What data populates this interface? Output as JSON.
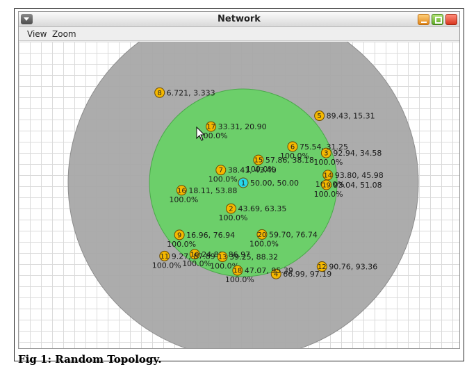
{
  "window": {
    "title": "Network",
    "menu": {
      "view": "View",
      "zoom": "Zoom"
    }
  },
  "colors": {
    "coverage_outer": "#a8a8a8",
    "coverage_inner": "#6ccf6a",
    "node_normal": "#f5b800",
    "node_selected": "#27d7e8"
  },
  "nodes": [
    {
      "id": "1",
      "x": 50.0,
      "y": 50.0,
      "label": "50.00, 50.00",
      "selected": true
    },
    {
      "id": "2",
      "x": 43.69,
      "y": 63.35,
      "label": "43.69, 63.35",
      "percent": "100.0%"
    },
    {
      "id": "3",
      "x": 92.94,
      "y": 34.58,
      "label": "92.94, 34.58",
      "percent": "100.0%"
    },
    {
      "id": "4",
      "x": 66.99,
      "y": 97.19,
      "label": "66.99, 97.19"
    },
    {
      "id": "5",
      "x": 89.43,
      "y": 15.31,
      "label": "89.43, 15.31"
    },
    {
      "id": "6",
      "x": 75.54,
      "y": 31.25,
      "label": "75.54, 31.25",
      "percent": "100.0%"
    },
    {
      "id": "7",
      "x": 38.41,
      "y": 43.4,
      "label": "38.41, 43.40",
      "percent": "100.0%"
    },
    {
      "id": "8",
      "x": 6.721,
      "y": 3.333,
      "label": "6.721, 3.333"
    },
    {
      "id": "9",
      "x": 16.96,
      "y": 76.94,
      "label": "16.96, 76.94",
      "percent": "100.0%"
    },
    {
      "id": "10",
      "x": 24.89,
      "y": 86.97,
      "label": "24.89, 86.97",
      "percent": "100.0%"
    },
    {
      "id": "11",
      "x": 9.27,
      "y": 87.89,
      "label": "9.27, 87.89",
      "percent": "100.0%"
    },
    {
      "id": "12",
      "x": 90.76,
      "y": 93.36,
      "label": "90.76, 93.36"
    },
    {
      "id": "13",
      "x": 39.25,
      "y": 88.32,
      "label": "39.25, 88.32",
      "percent": "100.0%"
    },
    {
      "id": "14",
      "x": 93.8,
      "y": 45.98,
      "label": "93.80, 45.98",
      "percent": "100.0%"
    },
    {
      "id": "15",
      "x": 57.86,
      "y": 38.18,
      "label": "57.86, 38.18",
      "percent": "100.0%"
    },
    {
      "id": "16",
      "x": 18.11,
      "y": 53.88,
      "label": "18.11, 53.88",
      "percent": "100.0%"
    },
    {
      "id": "17",
      "x": 33.31,
      "y": 20.9,
      "label": "33.31, 20.90",
      "percent": "100.0%"
    },
    {
      "id": "18",
      "x": 47.07,
      "y": 95.39,
      "label": "47.07, 95.39",
      "percent": "100.0%"
    },
    {
      "id": "19",
      "x": 93.04,
      "y": 51.08,
      "label": "93.04, 51.08",
      "percent": "100.0%"
    },
    {
      "id": "20",
      "x": 59.7,
      "y": 76.74,
      "label": "59.70, 76.74",
      "percent": "100.0%"
    }
  ],
  "caption": "Fig 1: Random Topology."
}
